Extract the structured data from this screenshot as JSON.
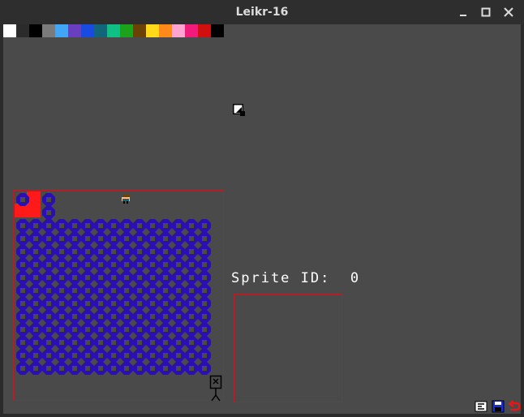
{
  "window": {
    "title": "Leikr-16"
  },
  "palette": {
    "colors": [
      "#ffffff",
      "#2b2b2b",
      "#000000",
      "#7b7b7b",
      "#41a6f6",
      "#6a3fbf",
      "#1a4be0",
      "#12667a",
      "#0fbf83",
      "#1ca31c",
      "#6b4106",
      "#ffd91a",
      "#ff8a1a",
      "#ffa3d1",
      "#f21a7a",
      "#d10f0f",
      "#000000"
    ]
  },
  "sprite_sheet": {
    "tile_color": "#2b0fb0",
    "selection_color": "#ff1a1a",
    "border_color": "#b3202a"
  },
  "sprite_info": {
    "label": "Sprite ID:",
    "id": "0"
  },
  "toolbar": {
    "icons": [
      "text-tool-icon",
      "save-icon",
      "undo-icon"
    ]
  }
}
